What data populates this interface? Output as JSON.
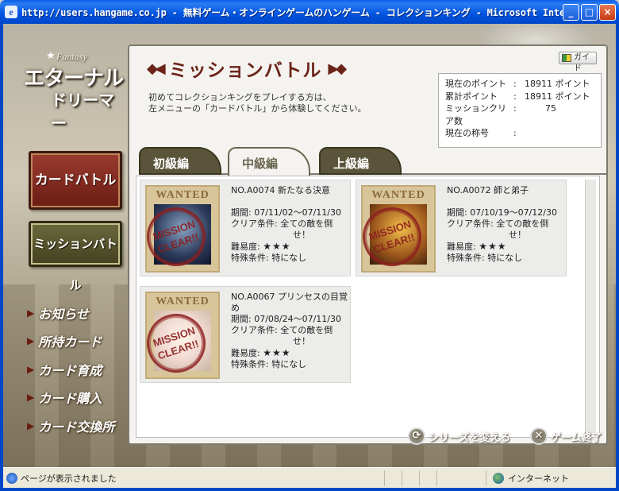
{
  "window": {
    "title": "http://users.hangame.co.jp - 無料ゲーム・オンラインゲームのハンゲーム - コレクションキング - Microsoft Inter...",
    "minimize": "_",
    "maximize": "□",
    "close": "×"
  },
  "logo": {
    "small": "Fantasy",
    "line1": "エターナル",
    "line2": "ドリーマー"
  },
  "left_menu": {
    "card_battle": "カードバトル",
    "mission_battle": "ミッションバトル",
    "items": [
      {
        "label": "お知らせ"
      },
      {
        "label": "所持カード"
      },
      {
        "label": "カード育成"
      },
      {
        "label": "カード購入"
      },
      {
        "label": "カード交換所"
      }
    ]
  },
  "main": {
    "heading": "ミッションバトル",
    "intro_line1": "初めてコレクションキングをプレイする方は、",
    "intro_line2": "左メニューの「カードバトル」から体験してください。",
    "guide_button": "ガイド",
    "status": [
      {
        "label": "現在のポイント",
        "value": "18911 ポイント"
      },
      {
        "label": "累計ポイント",
        "value": "18911 ポイント"
      },
      {
        "label": "ミッションクリア数",
        "value": "75"
      },
      {
        "label": "現在の称号",
        "value": ""
      }
    ],
    "status_separator": ":",
    "tabs": [
      {
        "label": "初級編"
      },
      {
        "label": "中級編"
      },
      {
        "label": "上級編"
      }
    ],
    "active_tab": "中級編"
  },
  "missions": [
    {
      "number": "NO.A0074",
      "name": "新たなる決意",
      "period": "期間:  07/11/02〜07/11/30",
      "condition": "クリア条件:  全ての敵を倒",
      "condition_cont": "せ！",
      "difficulty_label": "難易度:",
      "difficulty": "★★★",
      "special": "特殊条件:  特になし",
      "wanted": "WANTED",
      "stamp_line1": "MISSION",
      "stamp_line2": "CLEAR!!"
    },
    {
      "number": "NO.A0072",
      "name": "師と弟子",
      "period": "期間:  07/10/19〜07/12/30",
      "condition": "クリア条件:  全ての敵を倒",
      "condition_cont": "せ！",
      "difficulty_label": "難易度:",
      "difficulty": "★★★",
      "special": "特殊条件:  特になし",
      "wanted": "WANTED",
      "stamp_line1": "MISSION",
      "stamp_line2": "CLEAR!!"
    },
    {
      "number": "NO.A0067",
      "name": "プリンセスの目覚め",
      "period": "期間:  07/08/24〜07/11/30",
      "condition": "クリア条件:  全ての敵を倒",
      "condition_cont": "せ！",
      "difficulty_label": "難易度:",
      "difficulty": "★★★",
      "special": "特殊条件:  特になし",
      "wanted": "WANTED",
      "stamp_line1": "MISSION",
      "stamp_line2": "CLEAR!!"
    }
  ],
  "bottom": {
    "change_series": "シリーズを変える",
    "end_game": "ゲーム終了"
  },
  "statusbar": {
    "text": "ページが表示されました",
    "zone": "インターネット"
  }
}
